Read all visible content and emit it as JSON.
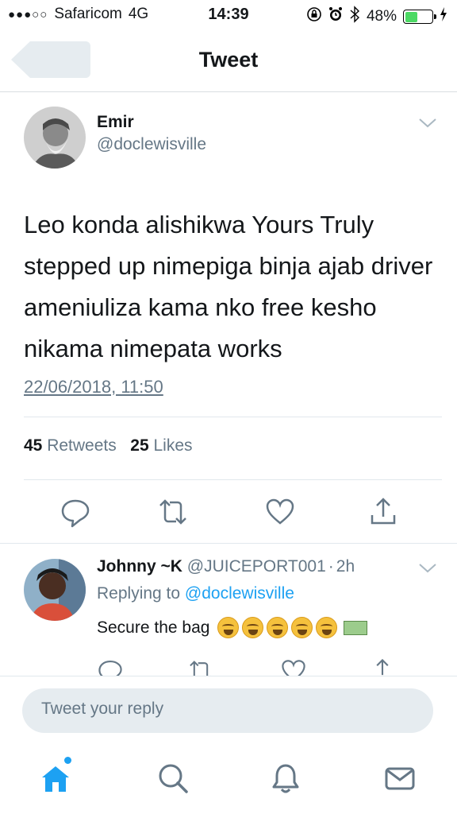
{
  "status_bar": {
    "signal": "●●●○○",
    "carrier": "Safaricom",
    "network": "4G",
    "time": "14:39",
    "battery_percent": "48%",
    "battery_level": 0.48,
    "battery_color": "#4cd964"
  },
  "nav": {
    "title": "Tweet",
    "back_icon": "back-arrow-icon"
  },
  "tweet": {
    "author_name": "Emir",
    "author_handle": "@doclewisville",
    "text": "Leo konda alishikwa Yours Truly stepped up nimepiga binja ajab driver ameniuliza kama nko free kesho nikama nimepata works",
    "date": "22/06/2018, 11:50",
    "retweets_count": "45",
    "retweets_label": "Retweets",
    "likes_count": "25",
    "likes_label": "Likes",
    "actions": [
      "reply-icon",
      "retweet-icon",
      "like-icon",
      "share-icon"
    ]
  },
  "reply": {
    "name": "Johnny ~K",
    "handle": "@JUICEPORT001",
    "separator": "·",
    "age": "2h",
    "replying_prefix": "Replying to",
    "replying_to": "@doclewisville",
    "text": "Secure the bag",
    "emojis": [
      "laughing-crying-emoji",
      "laughing-crying-emoji",
      "laughing-crying-emoji",
      "laughing-crying-emoji",
      "laughing-crying-emoji",
      "money-emoji"
    ]
  },
  "composer": {
    "placeholder": "Tweet your reply"
  },
  "tab_bar": {
    "items": [
      "home-icon",
      "search-icon",
      "notifications-icon",
      "messages-icon"
    ],
    "accent": "#1da1f2"
  },
  "colors": {
    "accent": "#1da1f2",
    "secondary_text": "#657786",
    "primary_text": "#14171a",
    "divider": "#e1e8ed"
  }
}
